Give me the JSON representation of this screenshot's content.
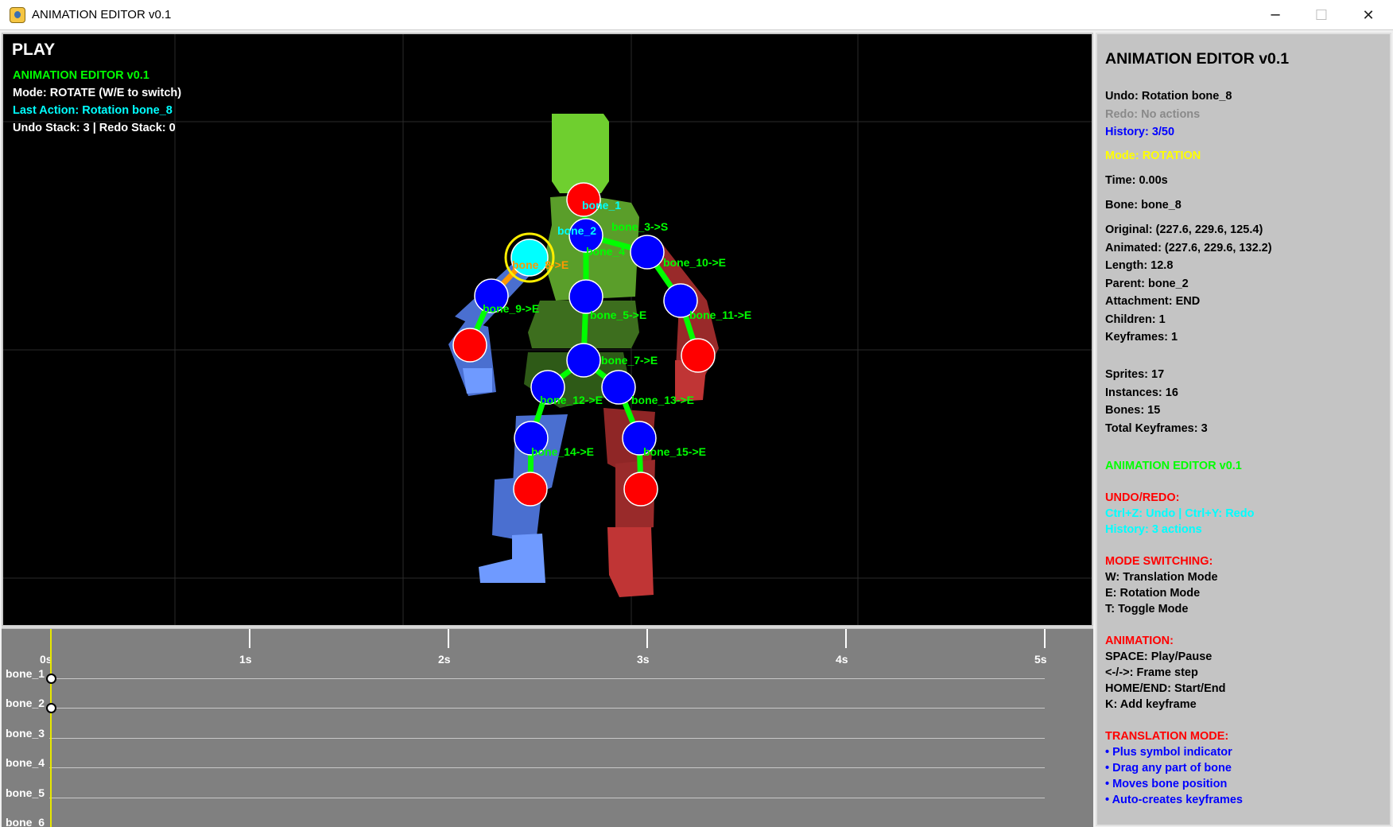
{
  "window": {
    "title": "ANIMATION EDITOR v0.1",
    "minimize_icon": "minimize-icon",
    "maximize_icon": "maximize-icon",
    "close_icon": "close-icon",
    "minimize_glyph": "─",
    "maximize_glyph": "☐",
    "close_glyph": "✕"
  },
  "viewport": {
    "play_label": "PLAY",
    "overlay": {
      "title": "ANIMATION EDITOR v0.1",
      "mode": "Mode: ROTATE (W/E to switch)",
      "last_action": "Last Action: Rotation bone_8",
      "stacks": "Undo Stack: 3 | Redo Stack: 0"
    },
    "bone_labels": [
      "bone_1",
      "bone_2",
      "bone_3->S",
      "bone_4",
      "bone_5->E",
      "bone_7->E",
      "bone_8->E",
      "bone_9->E",
      "bone_10->E",
      "bone_11->E",
      "bone_12->E",
      "bone_13->E",
      "bone_14->E",
      "bone_15->E"
    ],
    "selected_bone": "bone_8",
    "colors": {
      "background": "#000000",
      "joint_end": "#ff0000",
      "joint": "#0000ff",
      "joint_selected": "#00ffff",
      "bone_link": "#00ff00",
      "bone_selected_link": "#ff9900",
      "label_green": "#00ff00",
      "label_cyan": "#00ffff",
      "selection_ring": "#ffee00"
    }
  },
  "timeline": {
    "time_ticks": [
      "0s",
      "1s",
      "2s",
      "3s",
      "4s",
      "5s"
    ],
    "tracks": [
      "bone_1",
      "bone_2",
      "bone_3",
      "bone_4",
      "bone_5",
      "bone_6"
    ],
    "keyframes": [
      {
        "track": "bone_1",
        "time": 0
      },
      {
        "track": "bone_2",
        "time": 0
      }
    ],
    "playhead_time": 0
  },
  "panel": {
    "title": "ANIMATION EDITOR v0.1",
    "undo": "Undo: Rotation bone_8",
    "redo": "Redo: No actions",
    "history": "History: 3/50",
    "mode": "Mode: ROTATION",
    "time": "Time: 0.00s",
    "bone": "Bone: bone_8",
    "original": "Original: (227.6, 229.6, 125.4)",
    "animated": "Animated: (227.6, 229.6, 132.2)",
    "length": "Length: 12.8",
    "parent": "Parent: bone_2",
    "attachment": "Attachment: END",
    "children": "Children: 1",
    "keyframes": "Keyframes: 1",
    "sprites": "Sprites: 17",
    "instances": "Instances: 16",
    "bones": "Bones: 15",
    "total_keyframes": "Total Keyframes: 3",
    "footer_title": "ANIMATION EDITOR v0.1",
    "undo_redo_header": "UNDO/REDO:",
    "undo_redo_keys": "Ctrl+Z: Undo | Ctrl+Y: Redo",
    "undo_redo_history": "History: 3 actions",
    "mode_header": "MODE SWITCHING:",
    "mode_w": "W: Translation Mode",
    "mode_e": "E: Rotation Mode",
    "mode_t": "T: Toggle Mode",
    "anim_header": "ANIMATION:",
    "anim_space": "SPACE: Play/Pause",
    "anim_arrows": "<-/->: Frame step",
    "anim_home": "HOME/END: Start/End",
    "anim_k": "K: Add keyframe",
    "trans_header": "TRANSLATION MODE:",
    "trans_1": "• Plus symbol indicator",
    "trans_2": "• Drag any part of bone",
    "trans_3": "• Moves bone position",
    "trans_4": "• Auto-creates keyframes"
  }
}
